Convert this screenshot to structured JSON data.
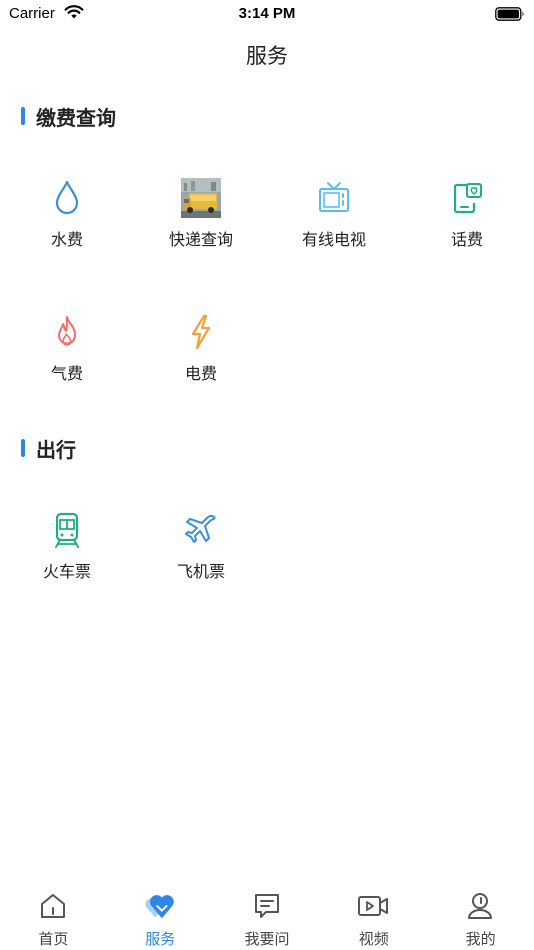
{
  "status_bar": {
    "carrier": "Carrier",
    "time": "3:14 PM"
  },
  "nav": {
    "title": "服务"
  },
  "sections": [
    {
      "title": "缴费查询",
      "items": [
        {
          "label": "水费",
          "icon": "water-drop-icon"
        },
        {
          "label": "快递查询",
          "icon": "delivery-truck-image"
        },
        {
          "label": "有线电视",
          "icon": "tv-icon"
        },
        {
          "label": "话费",
          "icon": "phone-bill-icon"
        },
        {
          "label": "气费",
          "icon": "flame-icon"
        },
        {
          "label": "电费",
          "icon": "lightning-icon"
        }
      ]
    },
    {
      "title": "出行",
      "items": [
        {
          "label": "火车票",
          "icon": "train-icon"
        },
        {
          "label": "飞机票",
          "icon": "airplane-icon"
        }
      ]
    }
  ],
  "tabs": [
    {
      "label": "首页",
      "icon": "home-icon"
    },
    {
      "label": "服务",
      "icon": "heart-icon",
      "active": true
    },
    {
      "label": "我要问",
      "icon": "message-icon"
    },
    {
      "label": "视频",
      "icon": "video-icon"
    },
    {
      "label": "我的",
      "icon": "profile-icon"
    }
  ],
  "colors": {
    "accent": "#2f86e4",
    "water": "#3a8fd8",
    "tv": "#58bfe8",
    "phone": "#1fae82",
    "flame": "#f26d6d",
    "lightning": "#f2a03c",
    "train": "#1fae82",
    "airplane": "#3a8fd8"
  }
}
